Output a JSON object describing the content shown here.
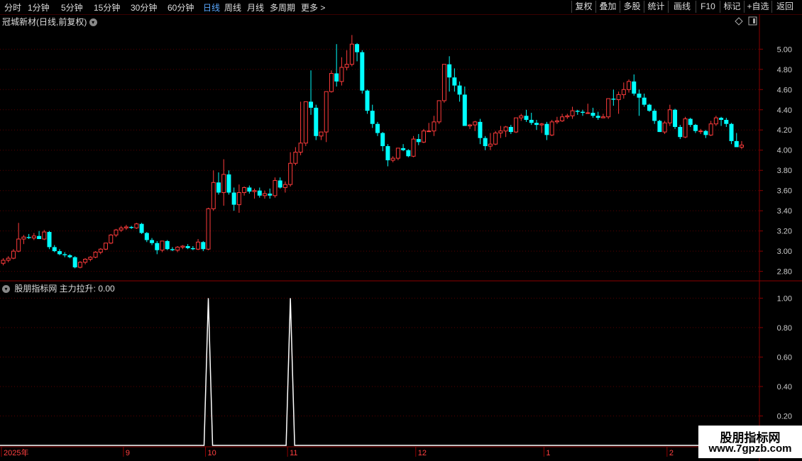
{
  "toolbar": {
    "periods": [
      "分时",
      "1分钟",
      "5分钟",
      "15分钟",
      "30分钟",
      "60分钟",
      "日线",
      "周线",
      "月线",
      "多周期",
      "更多 >"
    ],
    "active_period": "日线",
    "buttons": [
      "复权",
      "叠加",
      "多股",
      "统计",
      "画线",
      "F10",
      "标记",
      "+自选",
      "返回"
    ]
  },
  "main_panel": {
    "title": "冠城新材(日线,前复权)",
    "y_ticks": [
      "5.00",
      "4.80",
      "4.60",
      "4.40",
      "4.20",
      "4.00",
      "3.80",
      "3.60",
      "3.40",
      "3.20",
      "3.00",
      "2.80"
    ]
  },
  "indicator_panel": {
    "title": "股朋指标网 主力拉升: 0.00",
    "y_ticks": [
      "1.00",
      "0.80",
      "0.60",
      "0.40",
      "0.20"
    ]
  },
  "x_axis": {
    "labels": [
      "2025年",
      "9",
      "10",
      "11",
      "12",
      "1",
      "2"
    ]
  },
  "watermark": {
    "line1": "股朋指标网",
    "line2": "www.7gpzb.com"
  },
  "colors": {
    "up": "#ff3b3b",
    "down": "#00ffff",
    "grid": "#5a0000",
    "axis": "#8b0000",
    "active": "#5aa8ff"
  },
  "chart_data": [
    {
      "type": "candlestick",
      "title": "冠城新材(日线,前复权)",
      "ylim": [
        2.72,
        5.22
      ],
      "y_ticks": [
        5.0,
        4.8,
        4.6,
        4.4,
        4.2,
        4.0,
        3.8,
        3.6,
        3.4,
        3.2,
        3.0,
        2.8
      ],
      "x_tick_labels": [
        "2025年",
        "9",
        "10",
        "11",
        "12",
        "1",
        "2"
      ],
      "ohlc": [
        [
          2.88,
          2.93,
          2.86,
          2.91
        ],
        [
          2.91,
          2.95,
          2.89,
          2.93
        ],
        [
          2.93,
          3.02,
          2.92,
          3.0
        ],
        [
          3.0,
          3.28,
          2.99,
          3.12
        ],
        [
          3.12,
          3.16,
          3.07,
          3.14
        ],
        [
          3.14,
          3.17,
          3.12,
          3.13
        ],
        [
          3.13,
          3.18,
          3.11,
          3.15
        ],
        [
          3.15,
          3.2,
          3.12,
          3.12
        ],
        [
          3.12,
          3.21,
          3.11,
          3.19
        ],
        [
          3.19,
          3.2,
          3.02,
          3.04
        ],
        [
          3.04,
          3.06,
          2.99,
          3.0
        ],
        [
          3.0,
          3.02,
          2.96,
          2.97
        ],
        [
          2.97,
          2.99,
          2.94,
          2.96
        ],
        [
          2.96,
          2.97,
          2.93,
          2.94
        ],
        [
          2.94,
          2.95,
          2.83,
          2.84
        ],
        [
          2.84,
          2.9,
          2.83,
          2.89
        ],
        [
          2.89,
          2.93,
          2.87,
          2.92
        ],
        [
          2.92,
          2.95,
          2.9,
          2.94
        ],
        [
          2.94,
          3.0,
          2.93,
          2.99
        ],
        [
          2.99,
          3.03,
          2.97,
          3.02
        ],
        [
          3.02,
          3.08,
          3.01,
          3.08
        ],
        [
          3.08,
          3.17,
          3.07,
          3.16
        ],
        [
          3.16,
          3.22,
          3.14,
          3.21
        ],
        [
          3.21,
          3.25,
          3.19,
          3.23
        ],
        [
          3.23,
          3.26,
          3.21,
          3.24
        ],
        [
          3.24,
          3.25,
          3.22,
          3.23
        ],
        [
          3.23,
          3.28,
          3.22,
          3.27
        ],
        [
          3.27,
          3.28,
          3.17,
          3.18
        ],
        [
          3.18,
          3.19,
          3.09,
          3.11
        ],
        [
          3.11,
          3.13,
          3.06,
          3.08
        ],
        [
          3.08,
          3.1,
          2.97,
          3.01
        ],
        [
          3.01,
          3.03,
          2.99,
          3.1
        ],
        [
          3.1,
          3.11,
          3.01,
          3.02
        ],
        [
          3.02,
          3.04,
          3.0,
          3.01
        ],
        [
          3.01,
          3.05,
          2.99,
          3.04
        ],
        [
          3.04,
          3.06,
          3.02,
          3.05
        ],
        [
          3.05,
          3.07,
          3.02,
          3.03
        ],
        [
          3.03,
          3.05,
          3.01,
          3.02
        ],
        [
          3.02,
          3.12,
          3.01,
          3.09
        ],
        [
          3.09,
          3.1,
          3.0,
          3.02
        ],
        [
          3.02,
          3.43,
          3.01,
          3.42
        ],
        [
          3.42,
          3.8,
          3.4,
          3.68
        ],
        [
          3.68,
          3.78,
          3.56,
          3.58
        ],
        [
          3.58,
          3.91,
          3.45,
          3.76
        ],
        [
          3.76,
          3.8,
          3.56,
          3.58
        ],
        [
          3.58,
          3.63,
          3.4,
          3.46
        ],
        [
          3.46,
          3.66,
          3.38,
          3.58
        ],
        [
          3.58,
          3.64,
          3.55,
          3.63
        ],
        [
          3.63,
          3.65,
          3.57,
          3.59
        ],
        [
          3.59,
          3.62,
          3.52,
          3.6
        ],
        [
          3.6,
          3.63,
          3.53,
          3.55
        ],
        [
          3.55,
          3.6,
          3.52,
          3.57
        ],
        [
          3.57,
          3.62,
          3.52,
          3.55
        ],
        [
          3.55,
          3.73,
          3.53,
          3.7
        ],
        [
          3.7,
          3.73,
          3.62,
          3.63
        ],
        [
          3.63,
          3.69,
          3.58,
          3.66
        ],
        [
          3.66,
          3.98,
          3.64,
          3.87
        ],
        [
          3.87,
          4.03,
          3.85,
          3.98
        ],
        [
          3.98,
          4.48,
          3.95,
          4.07
        ],
        [
          4.07,
          4.47,
          4.04,
          4.48
        ],
        [
          4.48,
          4.79,
          4.35,
          4.42
        ],
        [
          4.42,
          4.45,
          4.1,
          4.14
        ],
        [
          4.14,
          4.18,
          4.1,
          4.18
        ],
        [
          4.18,
          4.56,
          4.08,
          4.58
        ],
        [
          4.58,
          4.79,
          4.57,
          4.76
        ],
        [
          4.76,
          5.05,
          4.63,
          4.68
        ],
        [
          4.68,
          4.92,
          4.64,
          4.82
        ],
        [
          4.82,
          4.99,
          4.79,
          4.85
        ],
        [
          4.85,
          5.14,
          4.83,
          5.05
        ],
        [
          5.05,
          5.06,
          4.88,
          4.97
        ],
        [
          4.97,
          4.99,
          4.56,
          4.59
        ],
        [
          4.59,
          4.6,
          4.36,
          4.39
        ],
        [
          4.39,
          4.45,
          4.22,
          4.26
        ],
        [
          4.26,
          4.28,
          4.14,
          4.17
        ],
        [
          4.17,
          4.18,
          3.99,
          4.04
        ],
        [
          4.04,
          4.06,
          3.84,
          3.9
        ],
        [
          3.9,
          3.94,
          3.88,
          3.92
        ],
        [
          3.92,
          4.02,
          3.9,
          4.02
        ],
        [
          4.02,
          4.06,
          3.99,
          4.0
        ],
        [
          4.0,
          4.01,
          3.93,
          3.94
        ],
        [
          3.94,
          4.14,
          3.93,
          4.11
        ],
        [
          4.11,
          4.16,
          4.05,
          4.08
        ],
        [
          4.08,
          4.21,
          4.07,
          4.19
        ],
        [
          4.19,
          4.27,
          4.18,
          4.19
        ],
        [
          4.19,
          4.34,
          4.14,
          4.28
        ],
        [
          4.28,
          4.43,
          4.26,
          4.49
        ],
        [
          4.49,
          4.67,
          4.47,
          4.85
        ],
        [
          4.85,
          4.93,
          4.58,
          4.72
        ],
        [
          4.72,
          4.81,
          4.58,
          4.64
        ],
        [
          4.64,
          4.68,
          4.48,
          4.55
        ],
        [
          4.55,
          4.63,
          4.25,
          4.24
        ],
        [
          4.24,
          4.26,
          4.21,
          4.25
        ],
        [
          4.25,
          4.29,
          4.19,
          4.28
        ],
        [
          4.28,
          4.31,
          4.06,
          4.12
        ],
        [
          4.12,
          4.14,
          4.0,
          4.04
        ],
        [
          4.04,
          4.17,
          4.0,
          4.06
        ],
        [
          4.06,
          4.19,
          4.05,
          4.17
        ],
        [
          4.17,
          4.24,
          4.12,
          4.19
        ],
        [
          4.19,
          4.24,
          4.13,
          4.23
        ],
        [
          4.23,
          4.25,
          4.16,
          4.18
        ],
        [
          4.18,
          4.32,
          4.17,
          4.32
        ],
        [
          4.32,
          4.36,
          4.29,
          4.34
        ],
        [
          4.34,
          4.4,
          4.28,
          4.3
        ],
        [
          4.3,
          4.37,
          4.25,
          4.27
        ],
        [
          4.27,
          4.3,
          4.2,
          4.25
        ],
        [
          4.25,
          4.27,
          4.17,
          4.26
        ],
        [
          4.26,
          4.28,
          4.1,
          4.15
        ],
        [
          4.15,
          4.3,
          4.14,
          4.28
        ],
        [
          4.28,
          4.33,
          4.26,
          4.29
        ],
        [
          4.29,
          4.36,
          4.28,
          4.33
        ],
        [
          4.33,
          4.36,
          4.31,
          4.34
        ],
        [
          4.34,
          4.43,
          4.31,
          4.39
        ],
        [
          4.39,
          4.4,
          4.35,
          4.38
        ],
        [
          4.38,
          4.4,
          4.34,
          4.37
        ],
        [
          4.37,
          4.46,
          4.36,
          4.37
        ],
        [
          4.37,
          4.42,
          4.32,
          4.34
        ],
        [
          4.34,
          4.38,
          4.3,
          4.32
        ],
        [
          4.32,
          4.36,
          4.32,
          4.33
        ],
        [
          4.33,
          4.51,
          4.31,
          4.51
        ],
        [
          4.51,
          4.6,
          4.44,
          4.5
        ],
        [
          4.5,
          4.58,
          4.36,
          4.55
        ],
        [
          4.55,
          4.67,
          4.51,
          4.6
        ],
        [
          4.6,
          4.7,
          4.57,
          4.68
        ],
        [
          4.68,
          4.75,
          4.54,
          4.56
        ],
        [
          4.56,
          4.6,
          4.34,
          4.52
        ],
        [
          4.52,
          4.56,
          4.43,
          4.45
        ],
        [
          4.45,
          4.46,
          4.38,
          4.39
        ],
        [
          4.39,
          4.41,
          4.26,
          4.29
        ],
        [
          4.29,
          4.3,
          4.18,
          4.18
        ],
        [
          4.18,
          4.29,
          4.16,
          4.27
        ],
        [
          4.27,
          4.45,
          4.24,
          4.4
        ],
        [
          4.4,
          4.41,
          4.21,
          4.23
        ],
        [
          4.23,
          4.25,
          4.11,
          4.13
        ],
        [
          4.13,
          4.33,
          4.12,
          4.31
        ],
        [
          4.31,
          4.32,
          4.23,
          4.25
        ],
        [
          4.25,
          4.26,
          4.17,
          4.19
        ],
        [
          4.19,
          4.21,
          4.16,
          4.19
        ],
        [
          4.19,
          4.2,
          4.12,
          4.15
        ],
        [
          4.15,
          4.29,
          4.14,
          4.26
        ],
        [
          4.26,
          4.34,
          4.24,
          4.32
        ],
        [
          4.32,
          4.33,
          4.24,
          4.3
        ],
        [
          4.3,
          4.32,
          4.23,
          4.26
        ],
        [
          4.26,
          4.27,
          4.06,
          4.09
        ],
        [
          4.09,
          4.17,
          4.05,
          4.03
        ],
        [
          4.03,
          4.09,
          4.01,
          4.05
        ]
      ]
    },
    {
      "type": "line",
      "title": "股朋指标网 主力拉升: 0.00",
      "ylim": [
        0,
        1.05
      ],
      "y_ticks": [
        1.0,
        0.8,
        0.6,
        0.4,
        0.2
      ],
      "series": [
        {
          "name": "主力拉升",
          "spikes": [
            {
              "bar": 40,
              "value": 1.0
            },
            {
              "bar": 56,
              "value": 1.0
            }
          ],
          "baseline": 0
        }
      ]
    }
  ]
}
